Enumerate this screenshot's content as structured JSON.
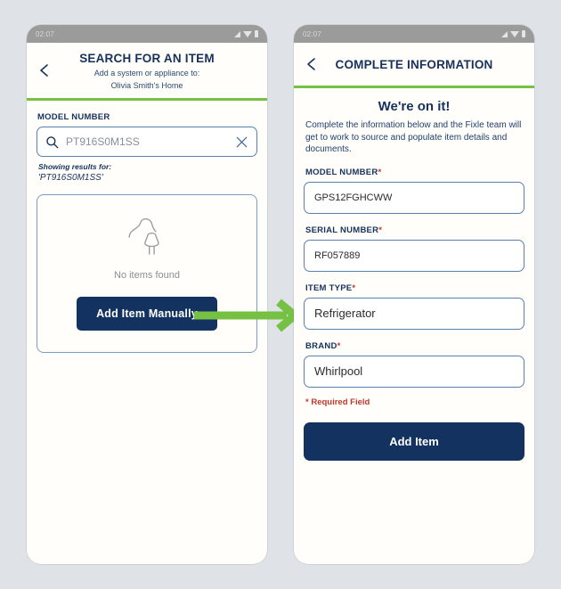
{
  "statusbar": {
    "time": "02:07",
    "icons": [
      "signal-icon",
      "wifi-icon",
      "battery-icon"
    ]
  },
  "theme": {
    "navy": "#143260",
    "green": "#76c043",
    "border_blue": "#5b7fb0",
    "required_red": "#c0392b",
    "page_background": "#dfe3e7"
  },
  "left_screen": {
    "header": {
      "back_icon": "chevron-left-icon",
      "title": "SEARCH FOR AN ITEM",
      "subtitle_line1": "Add a system or appliance to:",
      "subtitle_line2": "Olivia Smith's Home"
    },
    "search": {
      "label": "MODEL NUMBER",
      "icon": "search-icon",
      "value": "PT916S0M1SS",
      "clear_icon": "close-icon"
    },
    "results": {
      "showing_label": "Showing results for:",
      "query": "'PT916S0M1SS'"
    },
    "empty_state": {
      "icon": "plug-icon",
      "message": "No items found",
      "button_label": "Add Item Manually"
    }
  },
  "flow": {
    "arrow_icon": "right-arrow-icon",
    "arrow_color": "#76c043"
  },
  "right_screen": {
    "header": {
      "back_icon": "chevron-left-icon",
      "title": "COMPLETE INFORMATION"
    },
    "headline": "We're on it!",
    "blurb": "Complete the information below and the Fixle team will get to work to source and populate item details and documents.",
    "fields": [
      {
        "label": "MODEL NUMBER",
        "required": "*",
        "value": "GPS12FGHCWW",
        "size": "sm"
      },
      {
        "label": "SERIAL NUMBER",
        "required": "*",
        "value": "RF057889",
        "size": "sm"
      },
      {
        "label": "ITEM TYPE",
        "required": "*",
        "value": "Refrigerator",
        "size": "lg"
      },
      {
        "label": "BRAND",
        "required": "*",
        "value": "Whirlpool",
        "size": "lg"
      }
    ],
    "required_note": "* Required Field",
    "submit_label": "Add Item"
  }
}
